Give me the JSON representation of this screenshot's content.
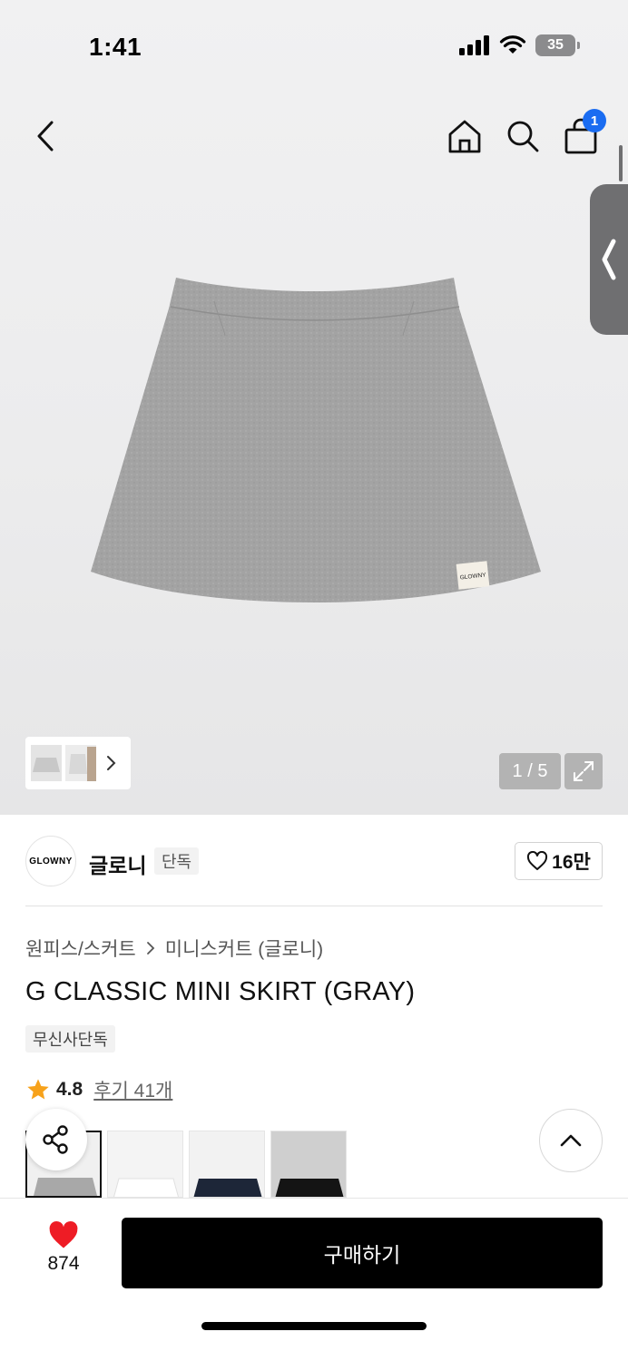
{
  "status_bar": {
    "time": "1:41",
    "battery": "35"
  },
  "nav": {
    "back_icon": "back-chevron-icon",
    "home_icon": "home-icon",
    "search_icon": "search-icon",
    "cart_icon": "bag-icon",
    "cart_count": "1"
  },
  "gallery": {
    "counter": "1 / 5",
    "expand_icon": "expand-icon",
    "product_label": "GLOWNY"
  },
  "brand": {
    "logo_text": "GLOWNY",
    "name": "글로니",
    "badge": "단독",
    "like_count": "16만"
  },
  "breadcrumb": {
    "category": "원피스/스커트",
    "subcategory": "미니스커트 (글로니)"
  },
  "product": {
    "title": "G CLASSIC MINI SKIRT (GRAY)",
    "tag": "무신사단독"
  },
  "rating": {
    "score": "4.8",
    "reviews": "후기 41개"
  },
  "variants": [
    "gray",
    "white",
    "navy",
    "black"
  ],
  "bottom": {
    "like_count": "874",
    "buy_label": "구매하기"
  },
  "colors": {
    "accent_blue": "#1a6cf1",
    "like_red": "#ee1c25",
    "star": "#f7a21b"
  }
}
